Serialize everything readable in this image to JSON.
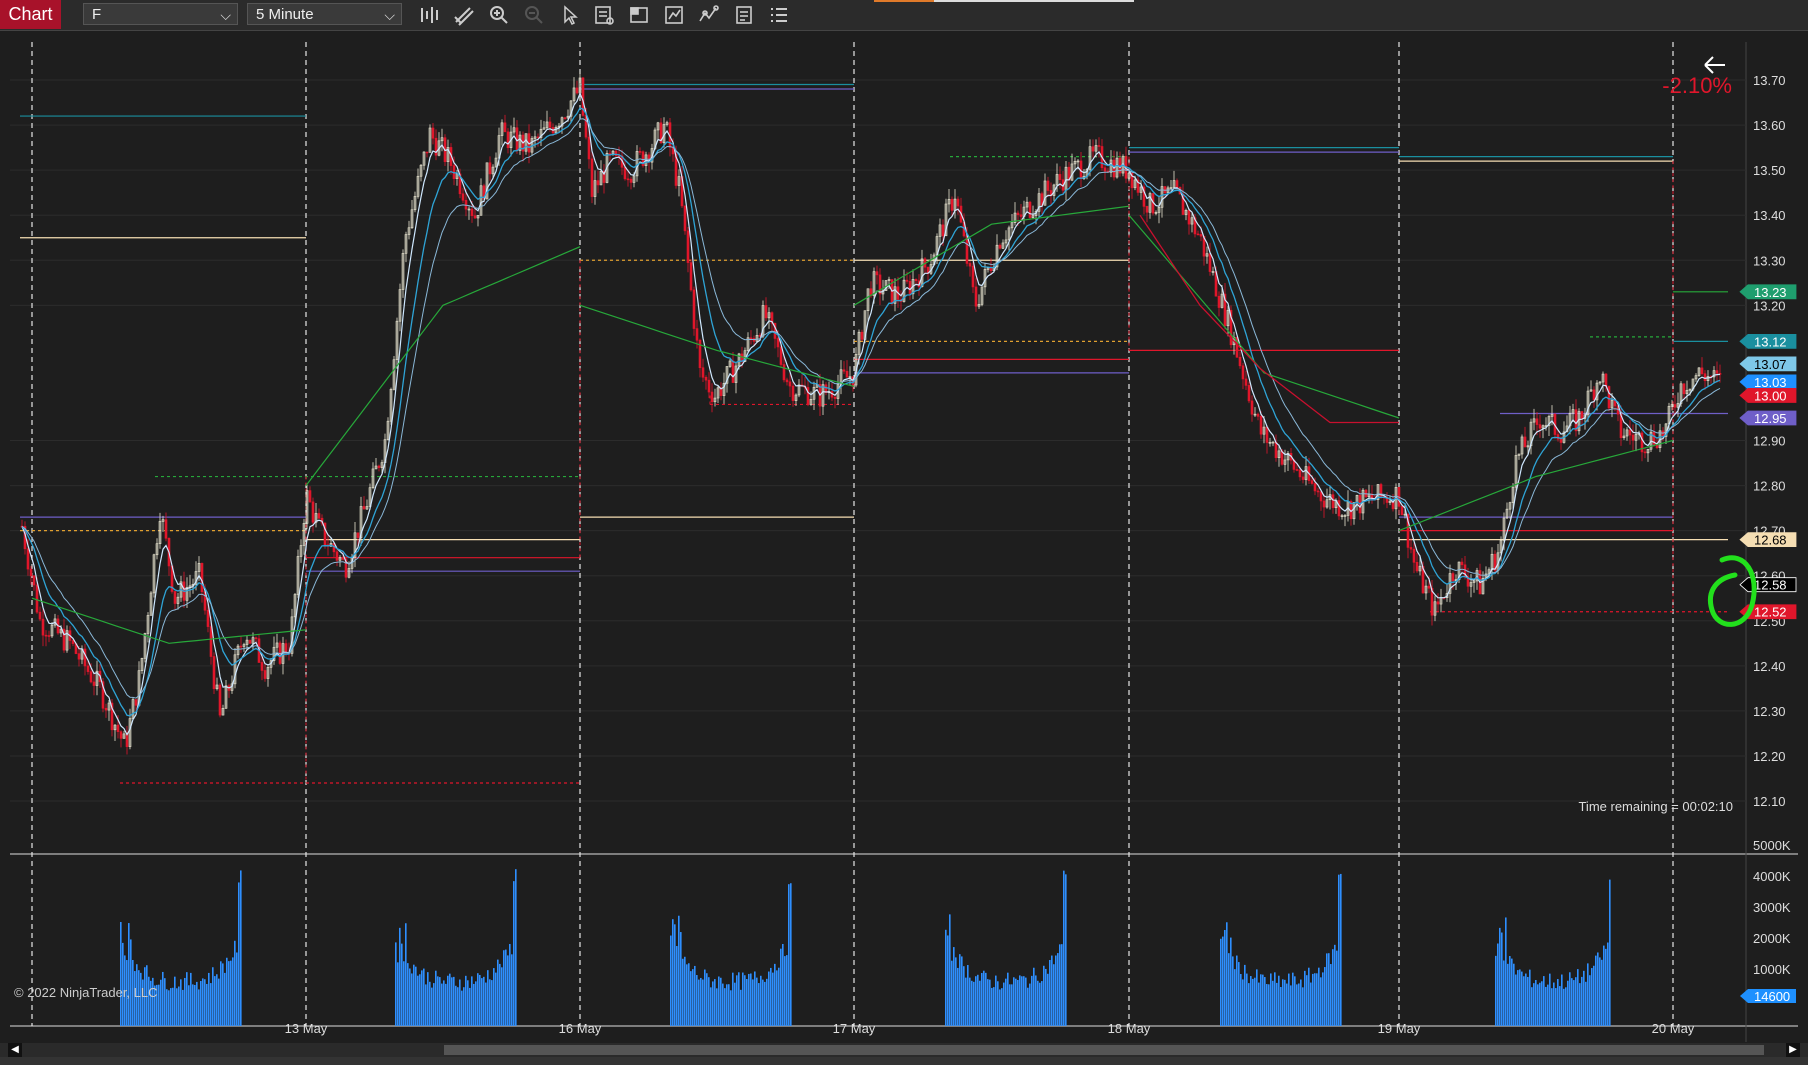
{
  "toolbar": {
    "chart_tab": "Chart",
    "instrument": "F",
    "interval": "5 Minute"
  },
  "chart": {
    "change_pct": "-2.10%",
    "time_remaining": "Time remaining = 00:02:10",
    "copyright": "© 2022 NinjaTrader, LLC",
    "price_ticks": [
      "13.70",
      "13.60",
      "13.50",
      "13.40",
      "13.30",
      "13.20",
      "12.90",
      "12.80",
      "12.70",
      "12.60",
      "12.50",
      "12.40",
      "12.30",
      "12.20",
      "12.10"
    ],
    "price_tick_values": [
      13.7,
      13.6,
      13.5,
      13.4,
      13.3,
      13.2,
      12.9,
      12.8,
      12.7,
      12.6,
      12.5,
      12.4,
      12.3,
      12.2,
      12.1
    ],
    "price_markers": [
      {
        "label": "13.23",
        "value": 13.23,
        "color": "#1f9e6e",
        "text": "#fff"
      },
      {
        "label": "13.12",
        "value": 13.12,
        "color": "#1a8f9f",
        "text": "#fff"
      },
      {
        "label": "13.07",
        "value": 13.07,
        "color": "#7ec8e8",
        "text": "#000"
      },
      {
        "label": "13.03",
        "value": 13.03,
        "color": "#1e90ff",
        "text": "#fff"
      },
      {
        "label": "13.00",
        "value": 13.0,
        "color": "#e0162b",
        "text": "#fff"
      },
      {
        "label": "12.95",
        "value": 12.95,
        "color": "#6f5fc8",
        "text": "#fff"
      },
      {
        "label": "12.68",
        "value": 12.68,
        "color": "#f5deb3",
        "text": "#000"
      },
      {
        "label": "12.58",
        "value": 12.58,
        "color": "#000000",
        "text": "#fff"
      },
      {
        "label": "12.52",
        "value": 12.52,
        "color": "#e0162b",
        "text": "#fff"
      }
    ],
    "volume_ticks": [
      "5000K",
      "4000K",
      "3000K",
      "2000K",
      "1000K"
    ],
    "volume_tick_values": [
      5000,
      4000,
      3000,
      2000,
      1000
    ],
    "volume_marker": "14600",
    "dates": [
      "13 May",
      "16 May",
      "17 May",
      "18 May",
      "19 May",
      "20 May"
    ],
    "colors": {
      "bull": "#e8e4d0",
      "bear": "#e0162b",
      "volume": "#2e8fff",
      "ema_fast": "#cfe8ff",
      "ema_slow": "#2fa4d6",
      "vwap": "#27a83a",
      "red_line": "#c8102e"
    }
  }
}
